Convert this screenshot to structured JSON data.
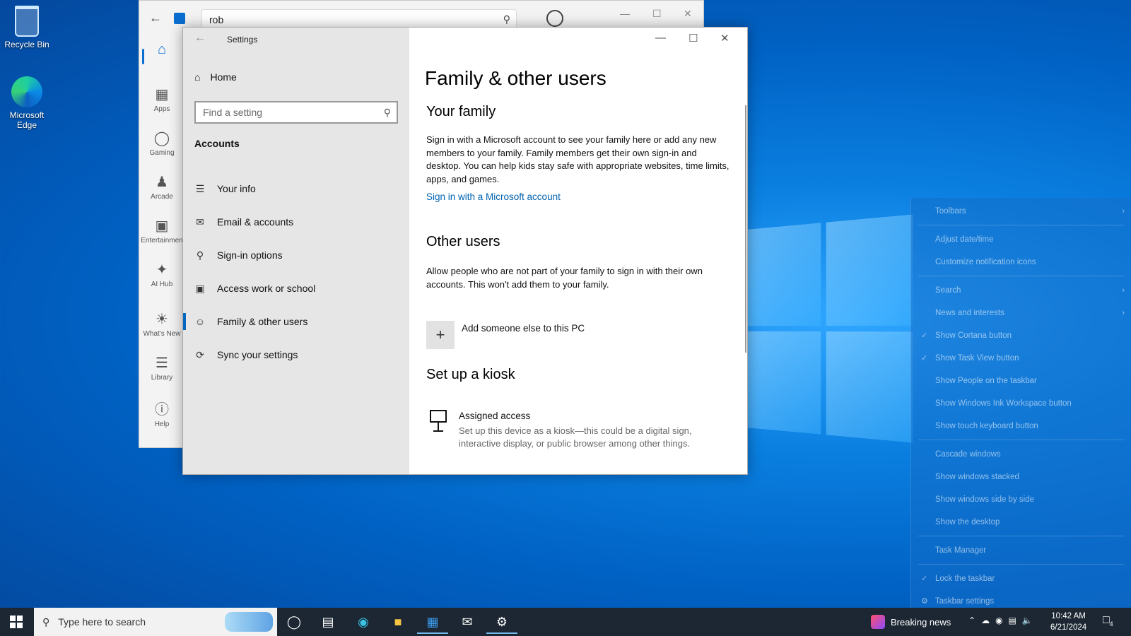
{
  "desktop": {
    "icons": [
      {
        "label": "Recycle Bin"
      },
      {
        "label": "Microsoft Edge"
      }
    ]
  },
  "store": {
    "search_value": "rob",
    "nav": [
      {
        "label": "",
        "icon": "home-icon"
      },
      {
        "label": "Apps",
        "icon": "apps-icon"
      },
      {
        "label": "Gaming",
        "icon": "gamepad-icon"
      },
      {
        "label": "Arcade",
        "icon": "joystick-icon"
      },
      {
        "label": "Entertainmen",
        "icon": "clapper-icon"
      },
      {
        "label": "AI Hub",
        "icon": "sparkle-icon"
      },
      {
        "label": "What's New",
        "icon": "bell-icon"
      },
      {
        "label": "Library",
        "icon": "library-icon"
      },
      {
        "label": "Help",
        "icon": "help-icon"
      }
    ]
  },
  "settings": {
    "window_title": "Settings",
    "home_label": "Home",
    "search_placeholder": "Find a setting",
    "section_label": "Accounts",
    "nav": [
      {
        "label": "Your info",
        "icon": "person-card-icon"
      },
      {
        "label": "Email & accounts",
        "icon": "mail-icon"
      },
      {
        "label": "Sign-in options",
        "icon": "key-icon"
      },
      {
        "label": "Access work or school",
        "icon": "briefcase-icon"
      },
      {
        "label": "Family & other users",
        "icon": "person-add-icon",
        "active": true
      },
      {
        "label": "Sync your settings",
        "icon": "sync-icon"
      }
    ],
    "page_title": "Family & other users",
    "family": {
      "heading": "Your family",
      "text": "Sign in with a Microsoft account to see your family here or add any new members to your family. Family members get their own sign-in and desktop. You can help kids stay safe with appropriate websites, time limits, apps, and games.",
      "link": "Sign in with a Microsoft account"
    },
    "other_users": {
      "heading": "Other users",
      "text": "Allow people who are not part of your family to sign in with their own accounts. This won't add them to your family.",
      "add_label": "Add someone else to this PC"
    },
    "kiosk": {
      "heading": "Set up a kiosk",
      "title": "Assigned access",
      "text": "Set up this device as a kiosk—this could be a digital sign, interactive display, or public browser among other things."
    }
  },
  "context_menu": {
    "items": [
      {
        "label": "Toolbars",
        "submenu": true
      },
      {
        "label": "Adjust date/time"
      },
      {
        "label": "Customize notification icons"
      },
      {
        "label": "Search",
        "submenu": true
      },
      {
        "label": "News and interests",
        "submenu": true
      },
      {
        "label": "Show Cortana button",
        "checked": true
      },
      {
        "label": "Show Task View button",
        "checked": true
      },
      {
        "label": "Show People on the taskbar"
      },
      {
        "label": "Show Windows Ink Workspace button"
      },
      {
        "label": "Show touch keyboard button"
      },
      {
        "label": "Cascade windows"
      },
      {
        "label": "Show windows stacked"
      },
      {
        "label": "Show windows side by side"
      },
      {
        "label": "Show the desktop"
      },
      {
        "label": "Task Manager"
      },
      {
        "label": "Lock the taskbar",
        "checked": true
      },
      {
        "label": "Taskbar settings",
        "icon": "gear-icon"
      }
    ]
  },
  "taskbar": {
    "search_placeholder": "Type here to search",
    "news_label": "Breaking news",
    "time": "10:42 AM",
    "date": "6/21/2024",
    "notification_count": "4"
  }
}
